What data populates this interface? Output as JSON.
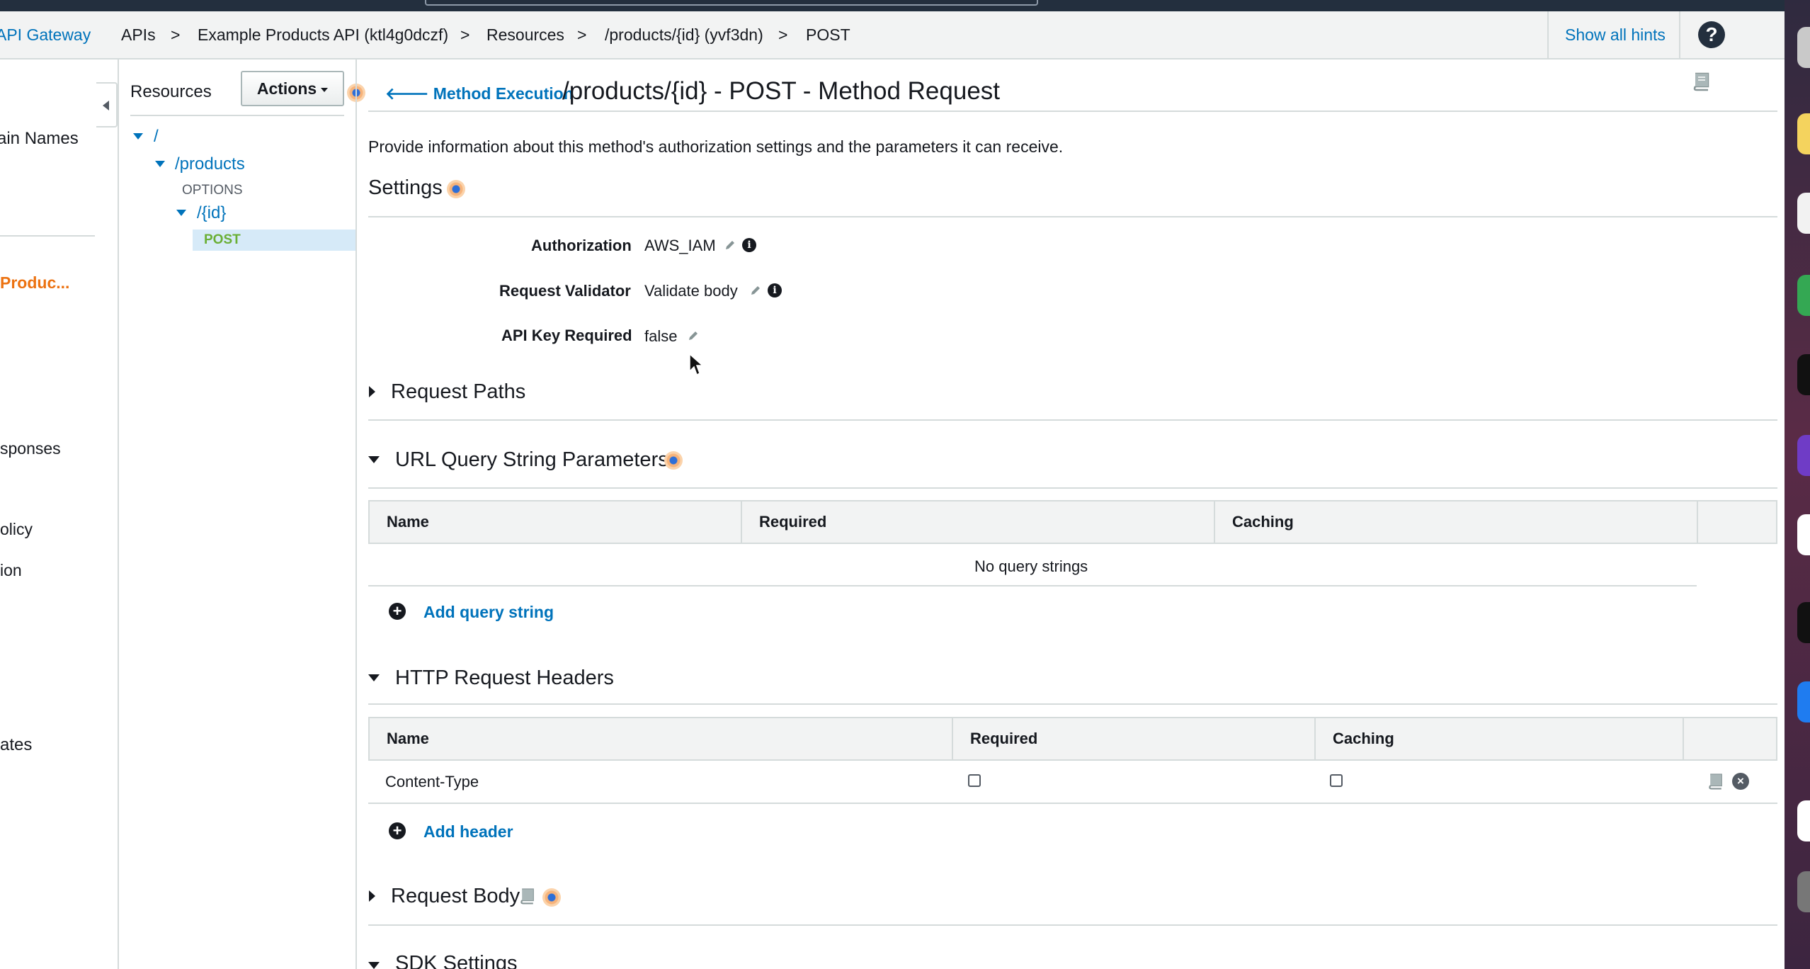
{
  "breadcrumb": {
    "service": "API Gateway",
    "apis": "APIs",
    "api_name": "Example Products API (ktl4g0dczf)",
    "resources": "Resources",
    "resource": "/products/{id} (yvf3dn)",
    "method": "POST",
    "separator": ">"
  },
  "header": {
    "show_hints": "Show all hints",
    "help_icon": "question-circle-icon"
  },
  "left_nav": {
    "items": [
      "ain Names",
      "Produc...",
      "sponses",
      "olicy",
      "ion",
      "ates"
    ]
  },
  "resources_panel": {
    "title": "Resources",
    "actions_label": "Actions",
    "tree": {
      "root": "/",
      "products": "/products",
      "options_method": "OPTIONS",
      "id_resource": "/{id}",
      "post_method": "POST"
    }
  },
  "main": {
    "back_link": "Method Execution",
    "title": "/products/{id} - POST - Method Request",
    "description": "Provide information about this method's authorization settings and the parameters it can receive.",
    "settings": {
      "title": "Settings",
      "authorization_label": "Authorization",
      "authorization_value": "AWS_IAM",
      "validator_label": "Request Validator",
      "validator_value": "Validate body",
      "api_key_label": "API Key Required",
      "api_key_value": "false"
    },
    "request_paths": {
      "title": "Request Paths"
    },
    "query_strings": {
      "title": "URL Query String Parameters",
      "columns": [
        "Name",
        "Required",
        "Caching"
      ],
      "empty_text": "No query strings",
      "add_label": "Add query string"
    },
    "headers": {
      "title": "HTTP Request Headers",
      "columns": [
        "Name",
        "Required",
        "Caching"
      ],
      "rows": [
        {
          "name": "Content-Type",
          "required": false,
          "caching": false
        }
      ],
      "add_label": "Add header"
    },
    "request_body": {
      "title": "Request Body"
    },
    "sdk_settings": {
      "title": "SDK Settings"
    }
  },
  "colors": {
    "link": "#0073bb",
    "method_post": "#6aaf35",
    "nav_active": "#ec7211",
    "header_bg": "#232f3e"
  }
}
